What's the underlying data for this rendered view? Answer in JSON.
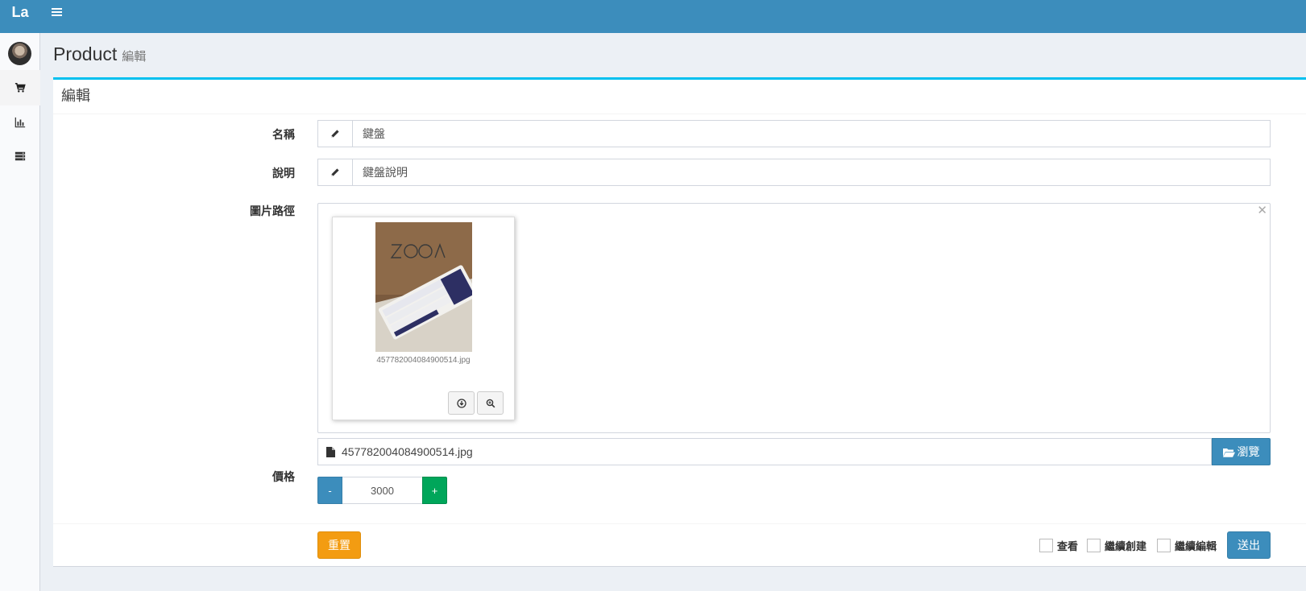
{
  "app": {
    "logo": "La"
  },
  "header": {
    "title": "Product",
    "subtitle": "編輯"
  },
  "box": {
    "title": "編輯"
  },
  "form": {
    "name": {
      "label": "名稱",
      "value": "鍵盤"
    },
    "description": {
      "label": "說明",
      "value": "鍵盤說明"
    },
    "image": {
      "label": "圖片路徑",
      "preview_caption": "457782004084900514.jpg",
      "file_name": "457782004084900514.jpg",
      "browse_label": "瀏覽"
    },
    "price": {
      "label": "價格",
      "value": "3000",
      "minus": "-",
      "plus": "+"
    }
  },
  "footer": {
    "reset": "重置",
    "submit": "送出",
    "checks": {
      "view": "查看",
      "continue_create": "繼續創建",
      "continue_edit": "繼續編輯"
    }
  },
  "colors": {
    "topbar": "#3c8dbc",
    "box_accent": "#00c0ef",
    "primary": "#3c8dbc",
    "success": "#00a65a",
    "warning": "#f39c12"
  },
  "icons": {
    "menu": "hamburger-icon",
    "nav": [
      "shopping-cart-icon",
      "bar-chart-icon",
      "server-icon"
    ],
    "input_addon": "pencil-icon",
    "close": "close-icon",
    "download": "download-icon",
    "zoom": "zoom-in-icon",
    "file": "file-icon",
    "folder": "folder-open-icon"
  }
}
